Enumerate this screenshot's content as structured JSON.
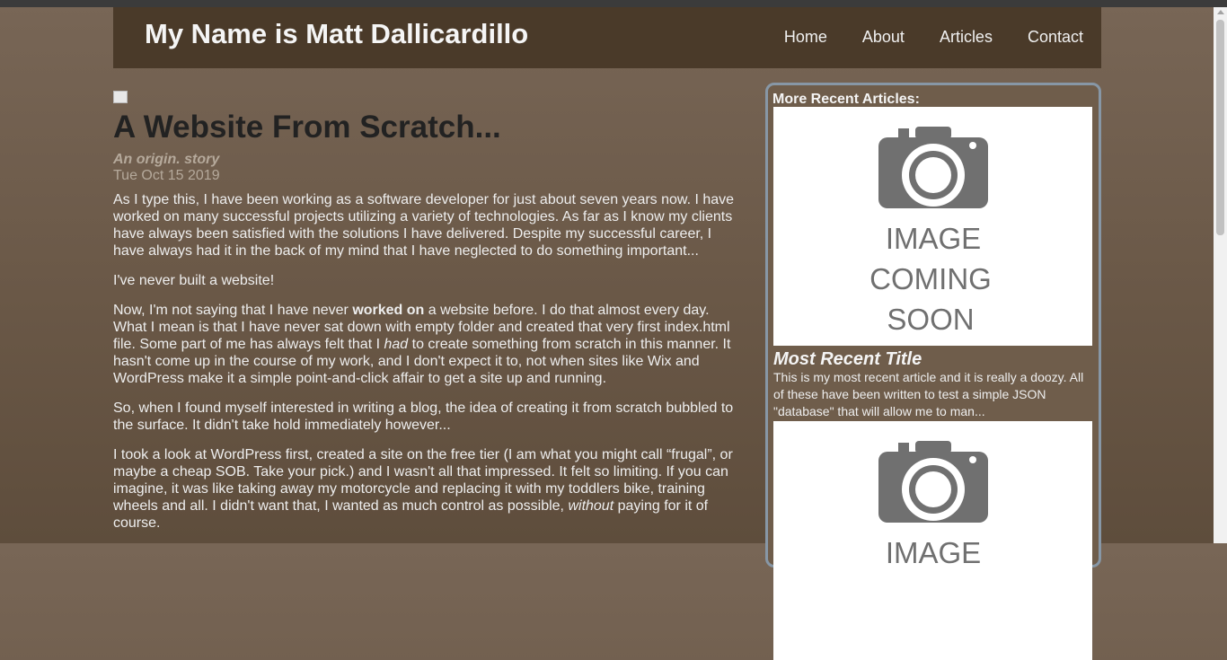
{
  "header": {
    "site_title": "My Name is Matt Dallicardillo",
    "nav": [
      "Home",
      "About",
      "Articles",
      "Contact"
    ]
  },
  "article": {
    "title": "A Website From Scratch...",
    "subtitle": "An origin. story",
    "date": "Tue Oct 15 2019",
    "p1": "As I type this, I have been working as a software developer for just about seven years now. I have worked on many successful projects utilizing a variety of technologies. As far as I know my clients have always been satisfied with the solutions I have delivered. Despite my successful career, I have always had it in the back of my mind that I have neglected to do something important...",
    "p2": "I've never built a website!",
    "p3_a": "Now, I'm not saying that I have never ",
    "p3_bold": "worked on",
    "p3_b": " a website before. I do that almost every day. What I mean is that I have never sat down with empty folder and created that very first index.html file. Some part of me has always felt that I ",
    "p3_italic": "had",
    "p3_c": " to create something from scratch in this manner. It hasn't come up in the course of my work, and I don't expect it to, not when sites like Wix and WordPress make it a simple point-and-click affair to get a site up and running.",
    "p4": "So, when I found myself interested in writing a blog, the idea of creating it from scratch bubbled to the surface. It didn't take hold immediately however...",
    "p5_a": "I took a look at WordPress first, created a site on the free tier (I am what you might call “frugal”, or maybe a cheap SOB. Take your pick.) and I wasn't all that impressed. It felt so limiting. If you can imagine, it was like taking away my motorcycle and replacing it with my toddlers bike, training wheels and all. I didn't want that, I wanted as much control as possible, ",
    "p5_italic": "without",
    "p5_b": " paying for it of course."
  },
  "sidebar": {
    "heading": "More Recent Articles:",
    "image_text": [
      "IMAGE",
      "COMING",
      "SOON"
    ],
    "card1_title": "Most Recent Title",
    "card1_excerpt": "This is my most recent article and it is really a doozy. All of these have been written to test a simple JSON \"database\" that will allow me to man..."
  }
}
